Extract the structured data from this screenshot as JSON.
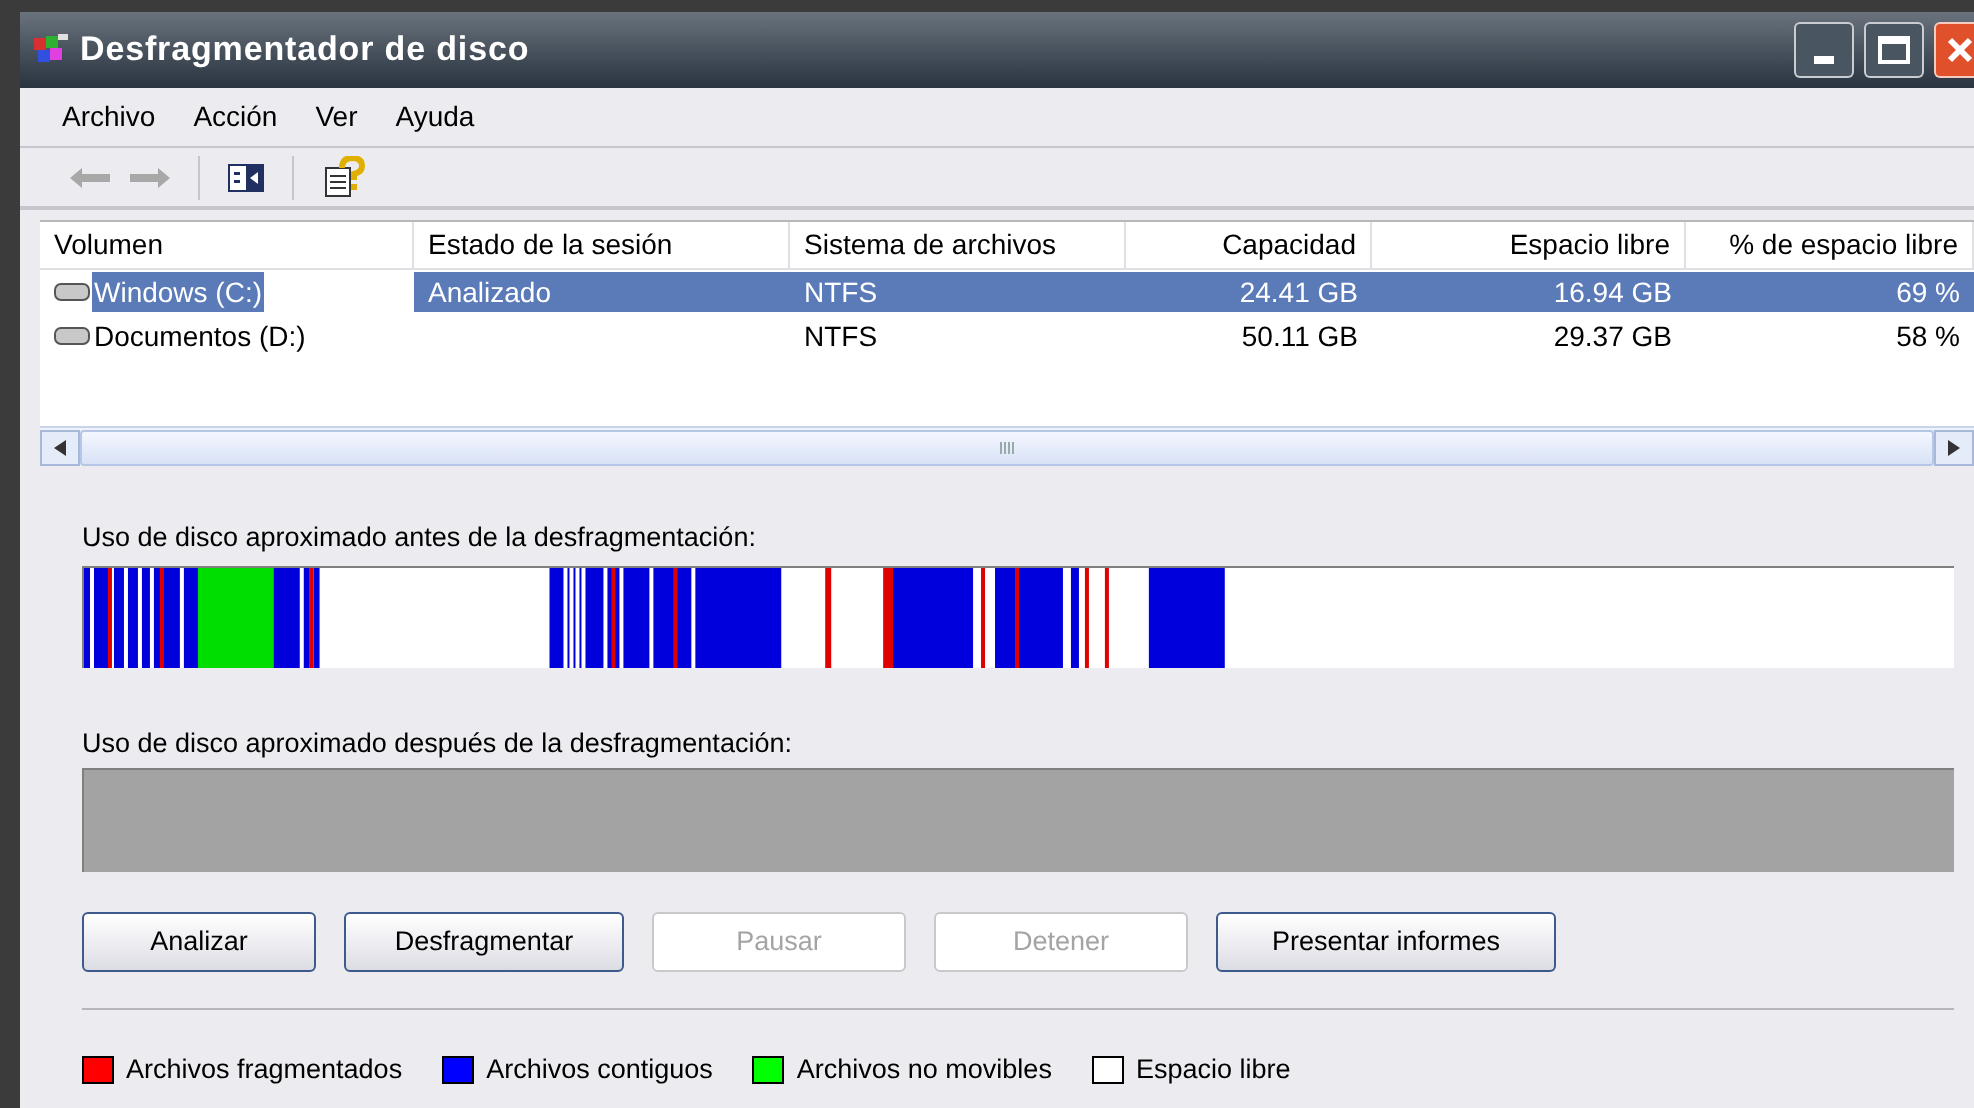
{
  "window": {
    "title": "Desfragmentador de disco"
  },
  "menu": [
    "Archivo",
    "Acción",
    "Ver",
    "Ayuda"
  ],
  "table": {
    "columns": [
      "Volumen",
      "Estado de la sesión",
      "Sistema de archivos",
      "Capacidad",
      "Espacio libre",
      "% de espacio libre"
    ],
    "rows": [
      {
        "selected": true,
        "cells": [
          "Windows (C:)",
          "Analizado",
          "NTFS",
          "24.41 GB",
          "16.94 GB",
          "69 %"
        ]
      },
      {
        "selected": false,
        "cells": [
          "Documentos (D:)",
          "",
          "NTFS",
          "50.11 GB",
          "29.37 GB",
          "58 %"
        ]
      }
    ]
  },
  "before_label": "Uso de disco aproximado antes de la desfragmentación:",
  "after_label": "Uso de disco aproximado después de la desfragmentación:",
  "buttons": [
    {
      "label": "Analizar",
      "disabled": false
    },
    {
      "label": "Desfragmentar",
      "disabled": false
    },
    {
      "label": "Pausar",
      "disabled": true
    },
    {
      "label": "Detener",
      "disabled": true
    },
    {
      "label": "Presentar informes",
      "disabled": false
    }
  ],
  "legend": [
    {
      "label": "Archivos fragmentados",
      "color": "#ff0000"
    },
    {
      "label": "Archivos contiguos",
      "color": "#0000ff"
    },
    {
      "label": "Archivos no movibles",
      "color": "#00ff00"
    },
    {
      "label": "Espacio libre",
      "color": "#ffffff"
    }
  ]
}
